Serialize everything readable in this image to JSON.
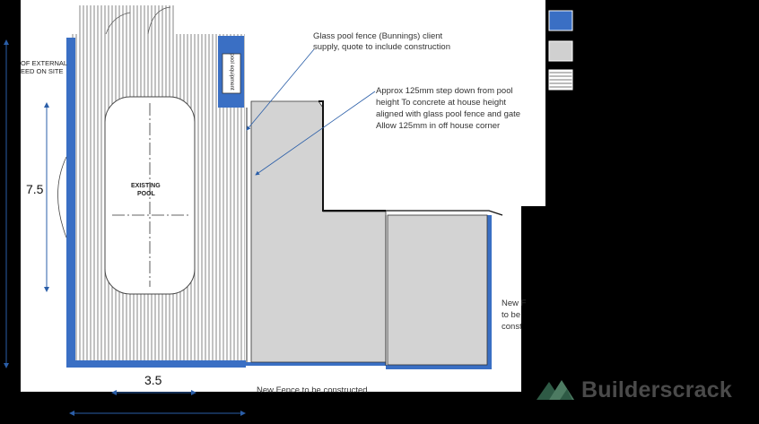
{
  "notes": {
    "fence_note_line1": "Glass pool fence (Bunnings) client",
    "fence_note_line2": "supply, quote to include construction",
    "step_note_line1": "Approx 125mm step down from pool",
    "step_note_line2": "height To concrete at house height",
    "step_note_line3": "aligned with glass pool fence and gate",
    "step_note_line4": "Allow 125mm in off house corner",
    "new_fence_right_line1": "New F",
    "new_fence_right_line2": "to be",
    "new_fence_right_line3": "const",
    "new_fence_bottom": "New Fence to be constructed",
    "external_line1": "OF EXTERNAL",
    "external_line2": "EED ON SITE"
  },
  "labels": {
    "pool_line1": "EXISTING",
    "pool_line2": "POOL",
    "equipment": "pool equipment"
  },
  "dimensions": {
    "height": "7.5",
    "width": "3.5"
  },
  "legend": [
    {
      "color": "#3a6fc4",
      "kind": "solid"
    },
    {
      "color": "#d0d0d0",
      "kind": "solid"
    },
    {
      "color": "#ffffff",
      "kind": "striped"
    }
  ],
  "brand": {
    "name": "Builderscrack",
    "colors": {
      "accent_dark": "#2e5a45",
      "accent_light": "#4d7b62",
      "text": "#4a4a4a"
    }
  }
}
